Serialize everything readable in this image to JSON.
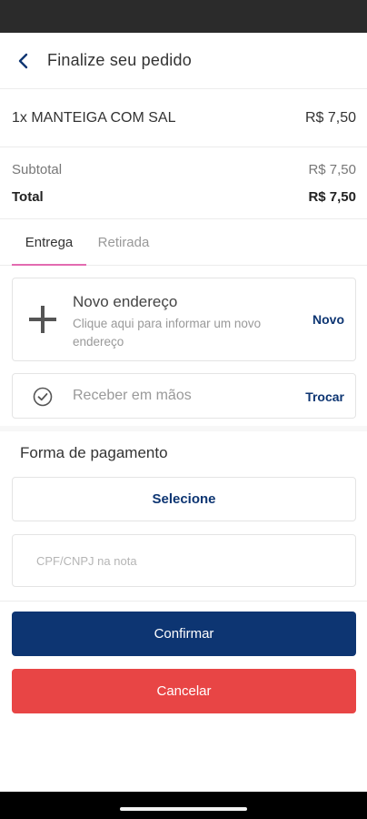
{
  "header": {
    "title": "Finalize seu pedido",
    "back_icon": "chevron-left-icon"
  },
  "order": {
    "item_label": "1x MANTEIGA COM SAL",
    "item_price": "R$ 7,50"
  },
  "summary": {
    "subtotal_label": "Subtotal",
    "subtotal_value": "R$ 7,50",
    "total_label": "Total",
    "total_value": "R$ 7,50"
  },
  "tabs": [
    {
      "label": "Entrega",
      "active": true
    },
    {
      "label": "Retirada",
      "active": false
    }
  ],
  "address": {
    "title": "Novo endereço",
    "description": "Clique aqui para informar um novo endereço",
    "action": "Novo",
    "icon": "plus-icon"
  },
  "hand_delivery": {
    "label": "Receber em mãos",
    "action": "Trocar",
    "icon": "check-circle-icon"
  },
  "payment": {
    "title": "Forma de pagamento",
    "select_label": "Selecione",
    "cpf_placeholder": "CPF/CNPJ na nota",
    "cpf_value": ""
  },
  "actions": {
    "confirm": "Confirmar",
    "cancel": "Cancelar"
  },
  "colors": {
    "primary": "#0d3572",
    "danger": "#e84545",
    "tab_indicator": "#e36bb0"
  }
}
